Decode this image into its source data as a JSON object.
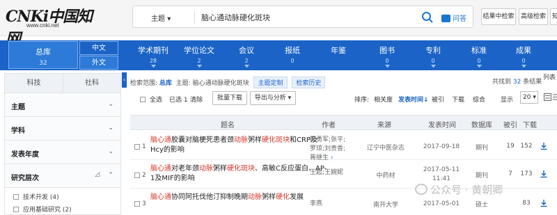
{
  "logo": {
    "mark": "CNKi中国知网",
    "url": "www.cnki.net"
  },
  "search": {
    "type": "主题",
    "query": "脑心通动脉硬化斑块",
    "qa_label": "问答"
  },
  "top_buttons": [
    "结果中检索",
    "高级检索",
    "知"
  ],
  "nav": {
    "zongku": {
      "label": "总库",
      "count": "32"
    },
    "lang_cn": "中文",
    "lang_en": "外文",
    "items": [
      {
        "label": "学术期刊",
        "count": "28"
      },
      {
        "label": "学位论文",
        "count": "2"
      },
      {
        "label": "会议",
        "count": "2"
      },
      {
        "label": "报纸",
        "count": "0"
      },
      {
        "label": "年鉴",
        "count": ""
      },
      {
        "label": "图书",
        "count": "0"
      },
      {
        "label": "专利",
        "count": "0"
      },
      {
        "label": "标准",
        "count": "0"
      },
      {
        "label": "成果",
        "count": "0"
      }
    ]
  },
  "sidebar": {
    "tabs": [
      "科技",
      "社科"
    ],
    "sections": [
      "主题",
      "学科",
      "发表年度",
      "研究层次"
    ],
    "filters": [
      {
        "label": "技术开发",
        "count": "(4)"
      },
      {
        "label": "应用基础研究",
        "count": "(2)"
      }
    ]
  },
  "crumb": {
    "range_label": "检索范围:",
    "range_value": "总库",
    "topic_label": "主题:",
    "topic_value": "脑心通动脉硬化斑块",
    "custom": "主题定制",
    "history": "检索历史",
    "total_prefix": "共找到",
    "total_count": "32",
    "total_suffix": "条结果",
    "list_mode": "列表"
  },
  "toolbar": {
    "select_all": "全选",
    "selected": "已选",
    "selected_count": "1",
    "clear": "清除",
    "batch_download": "批量下载",
    "export": "导出与分析",
    "sort_label": "排序:",
    "sort_relevance": "相关度",
    "sort_date": "发表时间",
    "sort_cited": "被引",
    "sort_download": "下载",
    "sort_combined": "综合",
    "display_label": "显示",
    "page_size": "20"
  },
  "table": {
    "headers": [
      "题名",
      "作者",
      "来源",
      "发表时间",
      "数据库",
      "被引",
      "下载"
    ],
    "rows": [
      {
        "num": "1",
        "title": [
          {
            "t": "脑心通",
            "h": true
          },
          {
            "t": "胶囊对脑梗死患者颈",
            "h": false
          },
          {
            "t": "动脉",
            "h": true
          },
          {
            "t": "粥样",
            "h": false
          },
          {
            "t": "硬化斑块",
            "h": true
          },
          {
            "t": "和CRP及Hcy的影响",
            "h": false
          }
        ],
        "author": "陈勇军;张平;罗琼;刘贵香;蒋继生",
        "source": "辽宁中医杂志",
        "date": "2017-09-18",
        "db": "期刊",
        "cite": "19",
        "download": "152"
      },
      {
        "num": "2",
        "title": [
          {
            "t": "脑心通",
            "h": true
          },
          {
            "t": "对老年颈",
            "h": false
          },
          {
            "t": "动脉",
            "h": true
          },
          {
            "t": "粥样",
            "h": false
          },
          {
            "t": "硬化斑块",
            "h": true
          },
          {
            "t": "、高敏C反应蛋白、AP-1及MIF的影响",
            "h": false
          }
        ],
        "author": "王起;王婉妮",
        "source": "中药材",
        "date": "2017-05-11 11:41",
        "db": "期刊",
        "cite": "7",
        "download": "173"
      },
      {
        "num": "3",
        "title": [
          {
            "t": "脑心通",
            "h": true
          },
          {
            "t": "协同阿托伐他汀抑制晚期",
            "h": false
          },
          {
            "t": "动脉",
            "h": true
          },
          {
            "t": "粥样",
            "h": false
          },
          {
            "t": "硬化",
            "h": true
          },
          {
            "t": "发展",
            "h": false
          }
        ],
        "author": "李燕",
        "source": "南开大学",
        "date": "2017-05-01",
        "db": "硕士",
        "cite": "",
        "download": "83"
      }
    ]
  },
  "watermark": "公众号 · 黄朝卿",
  "colors": {
    "brand": "#1b63c6",
    "highlight": "#d63b2e"
  }
}
